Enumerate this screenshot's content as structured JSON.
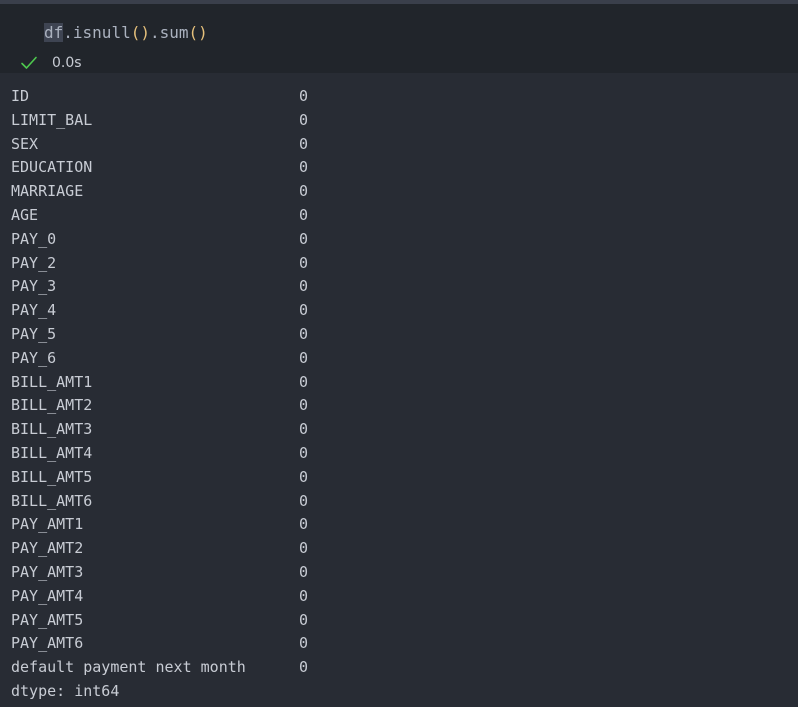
{
  "cell": {
    "code": {
      "var": "df",
      "dot1": ".",
      "method1": "isnull",
      "parens1": "()",
      "dot2": ".",
      "method2": "sum",
      "parens2": "()"
    },
    "status": {
      "icon": "check-icon",
      "time": "0.0s",
      "success_color": "#4ec94e"
    }
  },
  "output": {
    "rows": [
      {
        "name": "ID",
        "count": "0"
      },
      {
        "name": "LIMIT_BAL",
        "count": "0"
      },
      {
        "name": "SEX",
        "count": "0"
      },
      {
        "name": "EDUCATION",
        "count": "0"
      },
      {
        "name": "MARRIAGE",
        "count": "0"
      },
      {
        "name": "AGE",
        "count": "0"
      },
      {
        "name": "PAY_0",
        "count": "0"
      },
      {
        "name": "PAY_2",
        "count": "0"
      },
      {
        "name": "PAY_3",
        "count": "0"
      },
      {
        "name": "PAY_4",
        "count": "0"
      },
      {
        "name": "PAY_5",
        "count": "0"
      },
      {
        "name": "PAY_6",
        "count": "0"
      },
      {
        "name": "BILL_AMT1",
        "count": "0"
      },
      {
        "name": "BILL_AMT2",
        "count": "0"
      },
      {
        "name": "BILL_AMT3",
        "count": "0"
      },
      {
        "name": "BILL_AMT4",
        "count": "0"
      },
      {
        "name": "BILL_AMT5",
        "count": "0"
      },
      {
        "name": "BILL_AMT6",
        "count": "0"
      },
      {
        "name": "PAY_AMT1",
        "count": "0"
      },
      {
        "name": "PAY_AMT2",
        "count": "0"
      },
      {
        "name": "PAY_AMT3",
        "count": "0"
      },
      {
        "name": "PAY_AMT4",
        "count": "0"
      },
      {
        "name": "PAY_AMT5",
        "count": "0"
      },
      {
        "name": "PAY_AMT6",
        "count": "0"
      },
      {
        "name": "default payment next month",
        "count": "0"
      }
    ],
    "dtype": "dtype: int64"
  }
}
